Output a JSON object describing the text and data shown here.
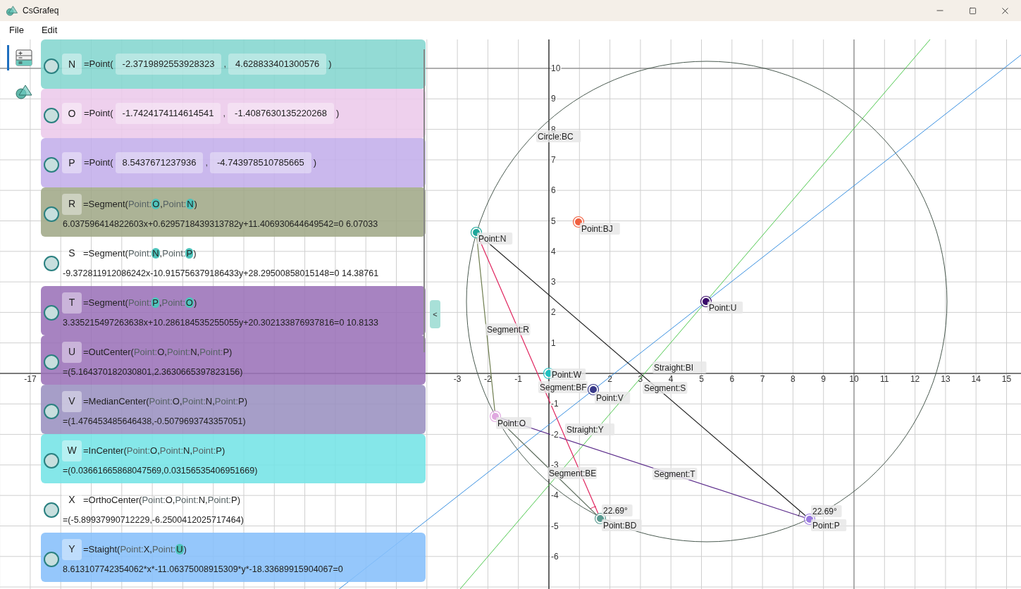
{
  "window": {
    "title": "CsGrafeq"
  },
  "menu": [
    "File",
    "Edit"
  ],
  "sidebar": {
    "items": [
      {
        "kind": "calculator",
        "selected": true
      },
      {
        "kind": "shapes",
        "selected": false
      }
    ]
  },
  "expressions": [
    {
      "kind": "point",
      "checked": false,
      "name": "N",
      "color": "#84d6cf",
      "func": "=Point(",
      "values": [
        "-2.3719892553928323",
        "4.628833401300576"
      ],
      "separator": ",",
      "close": ")"
    },
    {
      "kind": "point",
      "checked": false,
      "name": "O",
      "color": "#ecc9ea",
      "func": "=Point(",
      "values": [
        "-1.7424174114614541",
        "-1.4087630135220268"
      ],
      "separator": ",",
      "close": ")"
    },
    {
      "kind": "point",
      "checked": false,
      "name": "P",
      "color": "#c3aeea",
      "func": "=Point(",
      "values": [
        "8.5437671237936",
        "-4.743978510785665"
      ],
      "separator": ",",
      "close": ")"
    },
    {
      "kind": "formula",
      "checked": false,
      "name": "R",
      "color": "#a0a888",
      "func": "=Segment(",
      "args": [
        {
          "prefix": "Point:",
          "ref": "O",
          "highlighted": true
        },
        {
          "prefix": "Point:",
          "ref": "N",
          "highlighted": true
        }
      ],
      "separator": ",",
      "close": ")",
      "result": "6.037596414822603x+0.6295718439313782y+11.406930644649542=0 6.07033"
    },
    {
      "kind": "formula",
      "checked": false,
      "name": "S",
      "func": "=Segment(",
      "args": [
        {
          "prefix": "Point:",
          "ref": "N",
          "highlighted": true
        },
        {
          "prefix": "Point:",
          "ref": "P",
          "highlighted": true
        }
      ],
      "separator": ",",
      "close": ")",
      "result": "-9.372811912086242x-10.915756379186433y+28.29500858015148=0 14.38761"
    },
    {
      "kind": "formula",
      "checked": false,
      "name": "T",
      "color": "#9b72b8",
      "func": "=Segment(",
      "args": [
        {
          "prefix": "Point:",
          "ref": "P",
          "highlighted": true
        },
        {
          "prefix": "Point:",
          "ref": "O",
          "highlighted": true
        }
      ],
      "separator": ",",
      "close": ")",
      "result": "3.335215497263638x+10.286184535255055y+20.302133876937816=0 10.8133"
    },
    {
      "kind": "formula",
      "checked": false,
      "name": "U",
      "color": "#9b72b8",
      "func": "=OutCenter(",
      "args": [
        {
          "prefix": "Point:",
          "ref": "O",
          "highlighted": false
        },
        {
          "prefix": "Point:",
          "ref": "N",
          "highlighted": false
        },
        {
          "prefix": "Point:",
          "ref": "P",
          "highlighted": false
        }
      ],
      "separator": ",",
      "close": ")",
      "result": "=(5.164370182030801,2.3630665397823156)"
    },
    {
      "kind": "formula",
      "checked": false,
      "name": "V",
      "color": "#9a91c0",
      "func": "=MedianCenter(",
      "args": [
        {
          "prefix": "Point:",
          "ref": "O",
          "highlighted": false
        },
        {
          "prefix": "Point:",
          "ref": "N",
          "highlighted": false
        },
        {
          "prefix": "Point:",
          "ref": "P",
          "highlighted": false
        }
      ],
      "separator": ",",
      "close": ")",
      "result": "=(1.476453485646438,-0.5079693743357051)"
    },
    {
      "kind": "formula",
      "checked": false,
      "name": "W",
      "color": "#74e4e6",
      "func": "=InCenter(",
      "args": [
        {
          "prefix": "Point:",
          "ref": "O",
          "highlighted": false
        },
        {
          "prefix": "Point:",
          "ref": "N",
          "highlighted": false
        },
        {
          "prefix": "Point:",
          "ref": "P",
          "highlighted": false
        }
      ],
      "separator": ",",
      "close": ")",
      "result": "=(0.03661665868047569,0.03156535406951669)"
    },
    {
      "kind": "formula",
      "checked": false,
      "name": "X",
      "func": "=OrthoCenter(",
      "args": [
        {
          "prefix": "Point:",
          "ref": "O",
          "highlighted": false
        },
        {
          "prefix": "Point:",
          "ref": "N",
          "highlighted": false
        },
        {
          "prefix": "Point:",
          "ref": "P",
          "highlighted": false
        }
      ],
      "separator": ",",
      "close": ")",
      "result": "=(-5.89937990712229,-6.2500412025717464)"
    },
    {
      "kind": "formula",
      "checked": false,
      "name": "Y",
      "color": "#86bffa",
      "func": "=Staight(",
      "args": [
        {
          "prefix": "Point:",
          "ref": "X",
          "highlighted": false
        },
        {
          "prefix": "Point:",
          "ref": "U",
          "highlighted": true
        }
      ],
      "separator": ",",
      "close": ")",
      "result": "8.613107742354062*x*-11.06375008915309*y*-18.33689915904067=0"
    }
  ],
  "collapse_button": "<",
  "canvas": {
    "x_ticks": [
      "-17",
      "-3",
      "-2",
      "-1",
      "2",
      "3",
      "4",
      "5",
      "6",
      "7",
      "8",
      "9",
      "10",
      "11",
      "12",
      "13",
      "14",
      "15"
    ],
    "y_ticks": [
      "10",
      "9",
      "8",
      "7",
      "6",
      "5",
      "4",
      "3",
      "2",
      "1",
      "-1",
      "-2",
      "-3",
      "-4",
      "-5",
      "-6"
    ],
    "labels": [
      "Circle:BC",
      "Point:BJ",
      "Point:N",
      "Point:U",
      "Segment:R",
      "Straight:BI",
      "Point:W",
      "Segment:BF",
      "Segment:S",
      "Point:V",
      "Point:O",
      "Straight:Y",
      "Segment:BE",
      "Segment:T",
      "22.69°",
      "Point:BD",
      "22.69°",
      "Point:P"
    ]
  }
}
